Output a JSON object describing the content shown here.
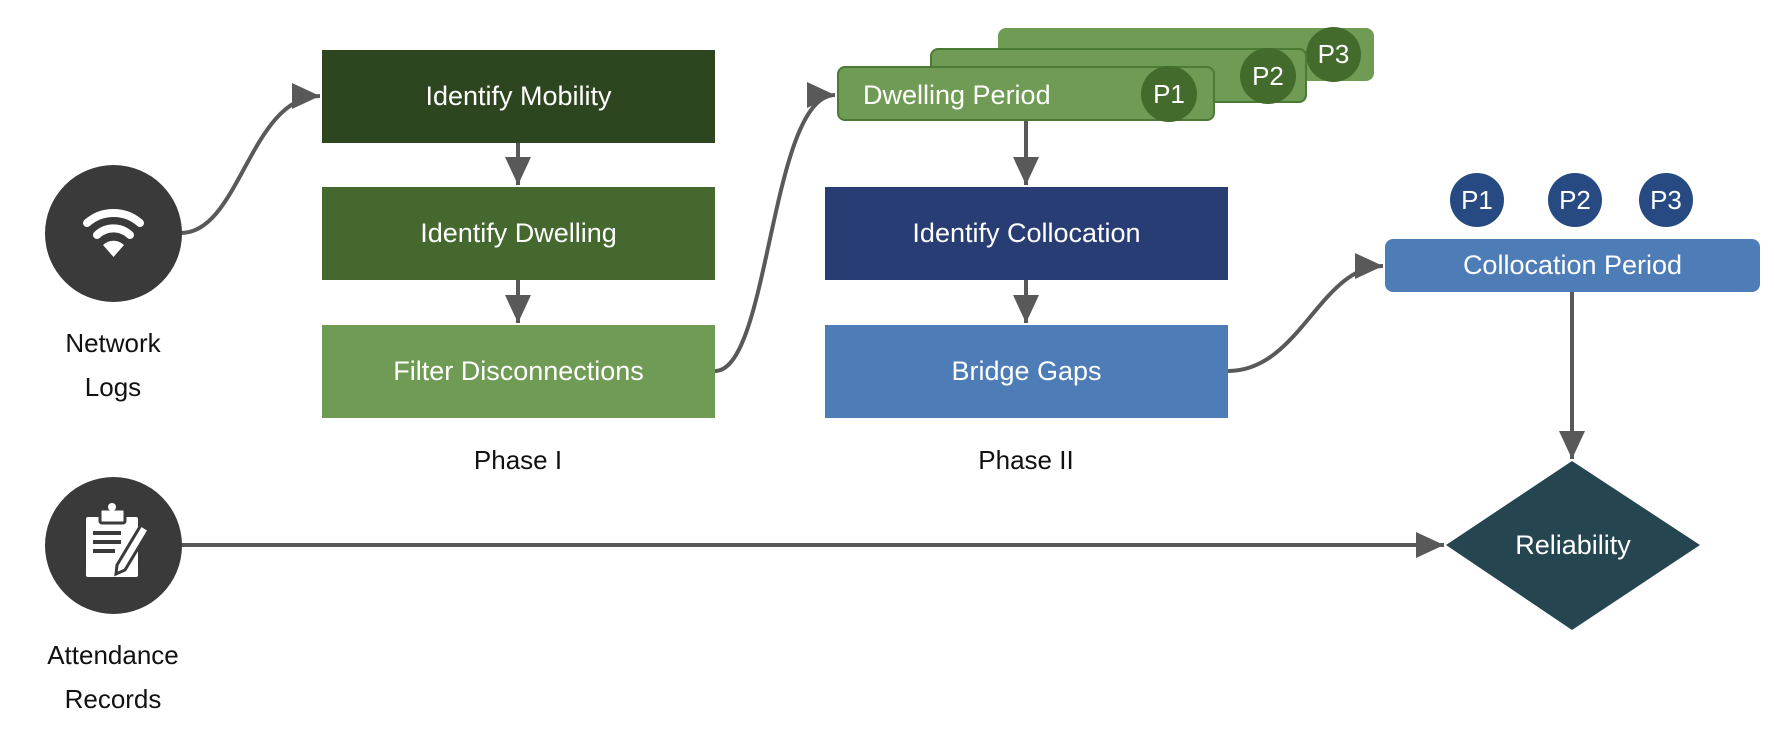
{
  "sources": {
    "network": {
      "label_line1": "Network",
      "label_line2": "Logs",
      "icon": "wifi-icon"
    },
    "attendance": {
      "label_line1": "Attendance",
      "label_line2": "Records",
      "icon": "clipboard-pen-icon"
    }
  },
  "phase1": {
    "label": "Phase I",
    "steps": [
      "Identify Mobility",
      "Identify Dwelling",
      "Filter Disconnections"
    ]
  },
  "dwelling": {
    "label": "Dwelling Period",
    "badges": [
      "P1",
      "P2",
      "P3"
    ]
  },
  "phase2": {
    "label": "Phase II",
    "steps": [
      "Identify Collocation",
      "Bridge Gaps"
    ]
  },
  "collocation": {
    "label": "Collocation Period",
    "badges": [
      "P1",
      "P2",
      "P3"
    ]
  },
  "outcome": {
    "label": "Reliability"
  },
  "colors": {
    "dark_green": "#2e4620",
    "mid_green": "#44682e",
    "light_green": "#709b55",
    "badge_green": "#426b2c",
    "navy": "#283d74",
    "blue": "#4d7cb7",
    "badge_navy": "#274a82",
    "teal": "#254650",
    "icon_gray": "#3a3a3a",
    "arrow": "#595959"
  }
}
